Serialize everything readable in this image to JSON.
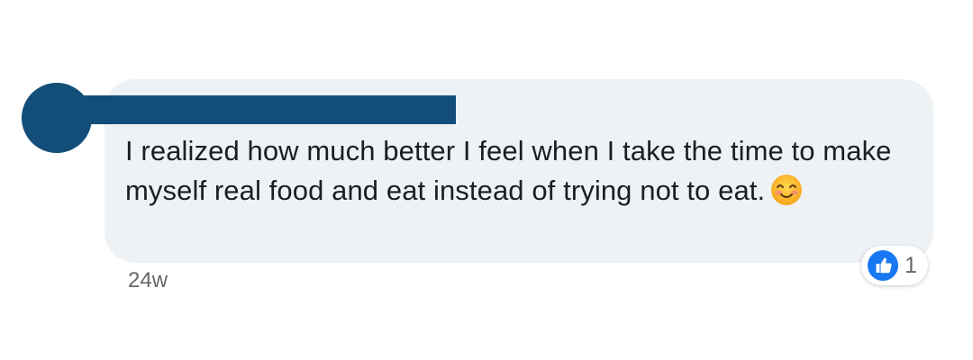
{
  "comment": {
    "author_name": "",
    "text": "I realized how much better I feel when I take the time to make myself real food and eat instead of trying not to eat.",
    "emoji": "smiling-face-with-smiling-eyes",
    "timestamp": "24w"
  },
  "reactions": {
    "type": "like-icon",
    "count": "1"
  },
  "colors": {
    "bubble_bg": "#eff2f5",
    "redaction": "#124e78",
    "like_blue": "#1877f2",
    "text": "#1c1e21",
    "meta_text": "#65676b"
  }
}
